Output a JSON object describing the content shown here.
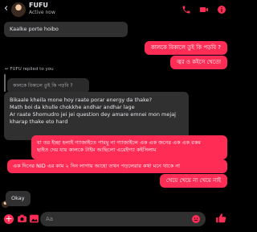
{
  "header": {
    "name": "FUFU",
    "status": "Active now"
  },
  "messages": {
    "m1": "Kaalke porte hoibo",
    "m2": "কালকে বিকালে তুই কি পড়বি ?",
    "m3": "জ্বর ও কইসে খেতো",
    "reply_note": "FUFU replied to you",
    "quoted": "কালকে বিকালে তুই কি পড়বি ?",
    "m4": [
      "Bikaale kheila mone hoy raate porar energy da thake?",
      "Math boi da khulle chokkhe andhar andhar lage",
      "Ar raate Shomudro jei jei question dey amare emnei mon mejaj kharap thake eto hard"
    ],
    "m5": [
      "যা তর ইচ্ছা হলাই গ্যাজাইতে পারমু না গ্যাজাইলে এক এক জনের এক এক রকম",
      "ছাইত দেয় যায় কালকে টাইম আছিলো এরেইগ্যা কইসিলাম"
    ],
    "m6": "এক দিনের NID এর কাম ২ দিন লাগায় আহো তখন পড়লেরার কথা মনে থাকে না",
    "m7": "খেয়ে খেয়ে না খেয়ে নাই",
    "m8": "Okay"
  },
  "composer": {
    "placeholder": "Aa"
  },
  "colors": {
    "accent": "#ff2d55",
    "incoming_bubble": "#303030",
    "background": "#000000"
  },
  "icons": [
    "back-arrow-icon",
    "phone-icon",
    "video-icon",
    "info-icon",
    "plus-icon",
    "camera-icon",
    "image-icon",
    "mic-icon",
    "emoji-icon",
    "like-icon"
  ]
}
